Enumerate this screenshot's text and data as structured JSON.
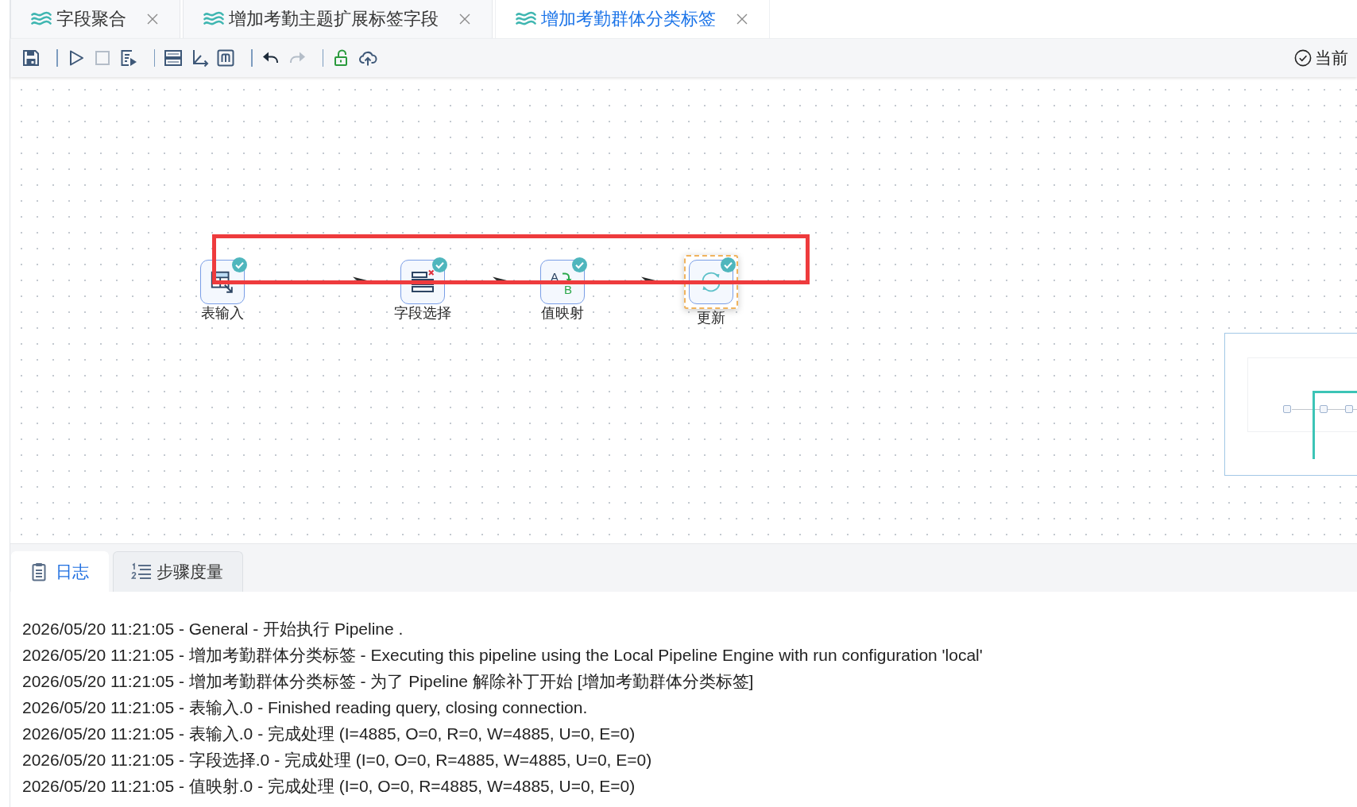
{
  "editor_tabs": [
    {
      "label": "字段聚合",
      "selected": false
    },
    {
      "label": "增加考勤主题扩展标签字段",
      "selected": false
    },
    {
      "label": "增加考勤群体分类标签",
      "selected": true
    }
  ],
  "toolbar": {
    "groups": [
      {
        "buttons": [
          {
            "kind": "save",
            "disabled": false
          }
        ]
      },
      {
        "buttons": [
          {
            "kind": "run",
            "disabled": false
          },
          {
            "kind": "stop",
            "disabled": true
          },
          {
            "kind": "preview",
            "disabled": false
          }
        ]
      },
      {
        "buttons": [
          {
            "kind": "align",
            "disabled": false
          },
          {
            "kind": "axis",
            "disabled": false
          },
          {
            "kind": "metrics",
            "disabled": false
          }
        ]
      },
      {
        "buttons": [
          {
            "kind": "undo",
            "disabled": false
          },
          {
            "kind": "redo",
            "disabled": true
          }
        ]
      },
      {
        "buttons": [
          {
            "kind": "unlock",
            "disabled": false
          },
          {
            "kind": "upload",
            "disabled": false
          }
        ]
      }
    ],
    "status_label": "当前"
  },
  "canvas": {
    "steps": [
      {
        "label": "表输入",
        "kind": "table_input",
        "finished": true,
        "selected": false
      },
      {
        "label": "字段选择",
        "kind": "select_values",
        "finished": true,
        "selected": false
      },
      {
        "label": "值映射",
        "kind": "value_mapper",
        "icon_letters": [
          "A",
          "B"
        ],
        "finished": true,
        "selected": false
      },
      {
        "label": "更新",
        "kind": "update",
        "finished": true,
        "selected": true
      }
    ]
  },
  "bottom_panel": {
    "tabs": [
      {
        "label": "日志",
        "kind": "log",
        "selected": true
      },
      {
        "label": "步骤度量",
        "kind": "metrics",
        "selected": false
      }
    ],
    "log_lines": [
      "2026/05/20 11:21:05 - General - 开始执行 Pipeline .",
      "2026/05/20 11:21:05 - 增加考勤群体分类标签 - Executing this pipeline using the Local Pipeline Engine with run configuration 'local'",
      "2026/05/20 11:21:05 - 增加考勤群体分类标签 - 为了 Pipeline 解除补丁开始 [增加考勤群体分类标签]",
      "2026/05/20 11:21:05 - 表输入.0 - Finished reading query, closing connection.",
      "2026/05/20 11:21:05 - 表输入.0 - 完成处理 (I=4885, O=0, R=0, W=4885, U=0, E=0)",
      "2026/05/20 11:21:05 - 字段选择.0 - 完成处理 (I=0, O=0, R=4885, W=4885, U=0, E=0)",
      "2026/05/20 11:21:05 - 值映射.0 - 完成处理 (I=0, O=0, R=4885, W=4885, U=0, E=0)"
    ]
  }
}
